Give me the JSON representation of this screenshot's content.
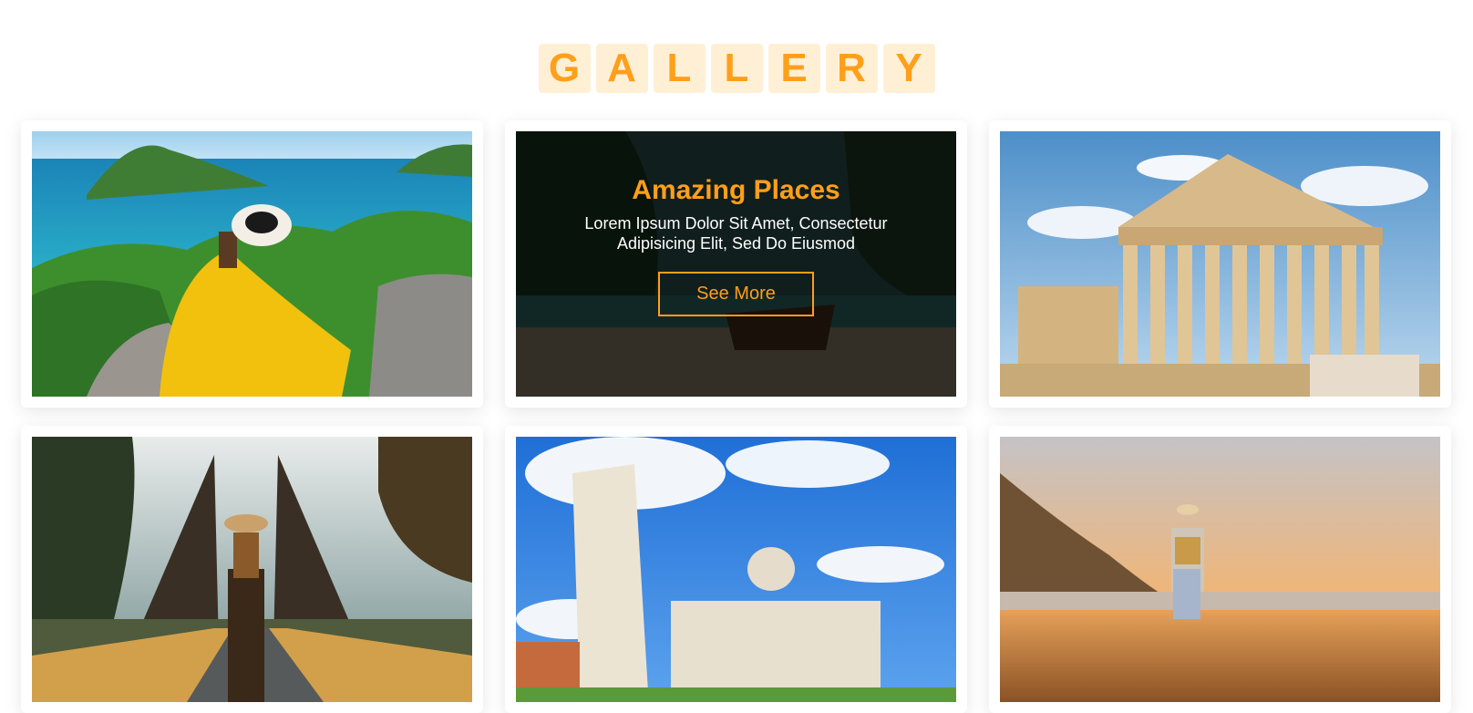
{
  "gallery": {
    "title_letters": [
      "G",
      "A",
      "L",
      "L",
      "E",
      "R",
      "Y"
    ],
    "accent_color": "#ff9f1a",
    "tile_bg": "#fff0d5",
    "hover_card": {
      "title": "Amazing Places",
      "text": "Lorem Ipsum Dolor Sit Amet, Consectetur Adipisicing Elit, Sed Do Eiusmod",
      "button_label": "See More"
    }
  }
}
